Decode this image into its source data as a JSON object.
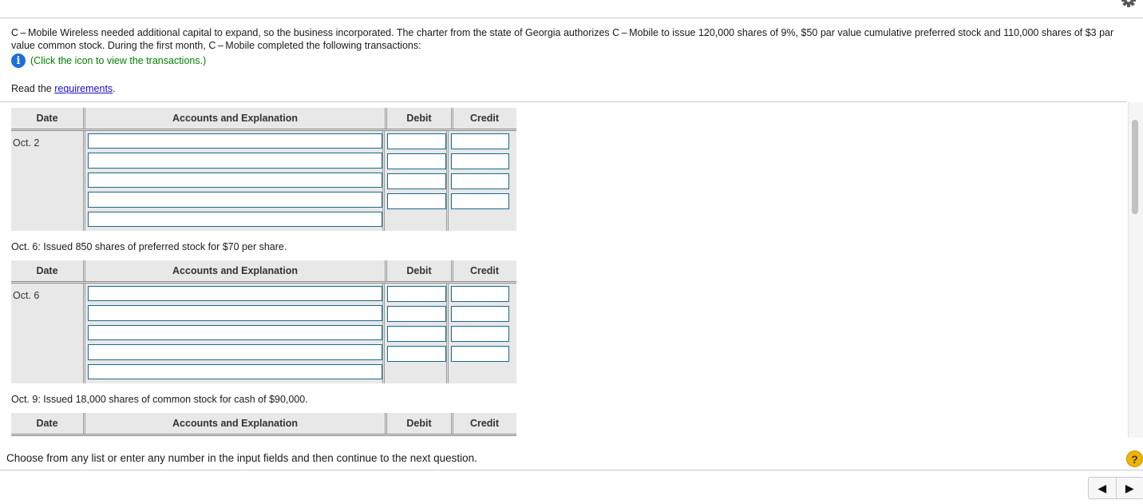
{
  "header": {
    "gear_icon": "gear-icon"
  },
  "prompt": {
    "text": "C – Mobile Wireless needed additional capital to expand, so the business incorporated. The charter from the state of Georgia authorizes C – Mobile to issue 120,000 shares of 9%, $50 par value cumulative preferred stock and 110,000 shares of $3 par value common stock. During the first month, C – Mobile completed the following transactions:",
    "info_icon_glyph": "i",
    "info_link": "(Click the icon to view the transactions.)",
    "read_prefix": "Read the ",
    "requirements_link": "requirements",
    "read_suffix": "."
  },
  "table_headers": {
    "date": "Date",
    "accounts": "Accounts and Explanation",
    "debit": "Debit",
    "credit": "Credit"
  },
  "journals": [
    {
      "description": "",
      "date": "Oct. 2",
      "rows": 5,
      "amount_rows": 4
    },
    {
      "description": "Oct. 6: Issued 850 shares of preferred stock for $70 per share.",
      "date": "Oct. 6",
      "rows": 5,
      "amount_rows": 4
    },
    {
      "description": "Oct. 9: Issued 18,000 shares of common stock for cash of $90,000.",
      "date": "",
      "rows": 0,
      "amount_rows": 0
    }
  ],
  "footer": {
    "instruction": "Choose from any list or enter any number in the input fields and then continue to the next question.",
    "help_glyph": "?",
    "prev_glyph": "◀",
    "next_glyph": "▶"
  }
}
